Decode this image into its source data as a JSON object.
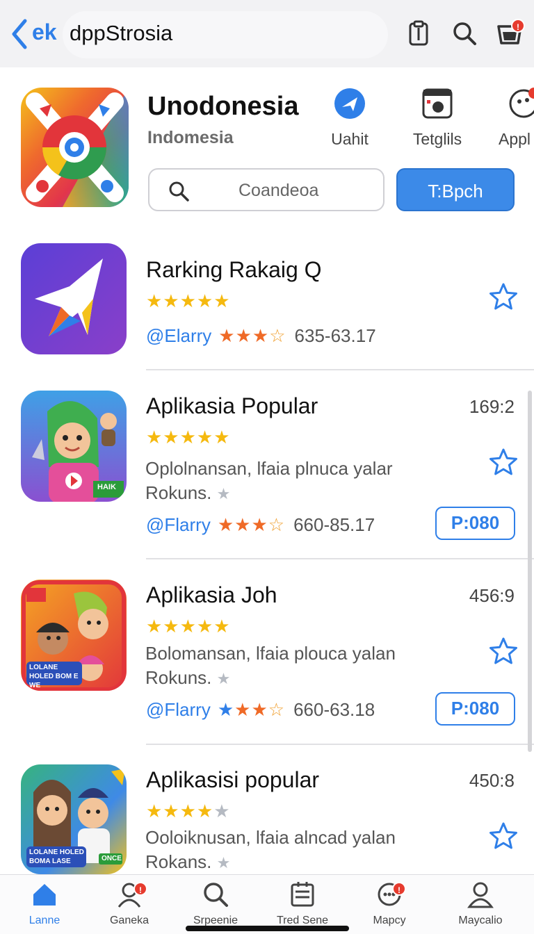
{
  "header": {
    "back_text": "ek",
    "title": "dppStrosia",
    "cart_badge": "!"
  },
  "featured": {
    "title": "Unodonesia",
    "subtitle": "Indomesia",
    "categories": [
      {
        "label": "Uahit",
        "icon": "plane-icon"
      },
      {
        "label": "Tetglils",
        "icon": "film-icon"
      },
      {
        "label": "Appl",
        "icon": "apps-icon"
      }
    ],
    "search_placeholder": "Coandeoa",
    "primary_button": "T:Bpch"
  },
  "apps": [
    {
      "name": "Rarking Rakaig Q",
      "rating": 4.5,
      "developer": "@Elarry",
      "small_rating": 3,
      "numbers": "635-63.17",
      "time": "",
      "description": "",
      "desc_line2": "",
      "price": ""
    },
    {
      "name": "Aplikasia Popular",
      "rating": 4.5,
      "developer": "@Flarry",
      "small_rating": 3,
      "numbers": "660-85.17",
      "time": "169:2",
      "description": "Oplolnansan, lfaia plnuca yalar",
      "desc_line2": "Rokuns.",
      "price": "P:080"
    },
    {
      "name": "Aplikasia Joh",
      "rating": 4.5,
      "developer": "@Flarry",
      "small_rating": 3,
      "numbers": "660-63.18",
      "time": "456:9",
      "description": "Bolomansan, lfaia plouca yalan",
      "desc_line2": "Rokuns.",
      "price": "P:080"
    },
    {
      "name": "Aplikasisi popular",
      "rating": 4,
      "developer": "",
      "small_rating": 0,
      "numbers": "",
      "time": "450:8",
      "description": "Ooloiknusan, lfaia alncad yalan",
      "desc_line2": "Rokans.",
      "price": ""
    }
  ],
  "icon_texts": {
    "app3_badge": "LOLANE HOLED BOM E WE",
    "app4_badge": "LOLANE HOLED BOMA LASE",
    "app2_tag": "HAIK",
    "app4_tag": "ONCE"
  },
  "tabs": [
    {
      "label": "Lanne",
      "icon": "home-icon",
      "active": true
    },
    {
      "label": "Ganeka",
      "icon": "person-icon",
      "badge": "!"
    },
    {
      "label": "Srpeenie",
      "icon": "search-icon"
    },
    {
      "label": "Tred Sene",
      "icon": "list-icon"
    },
    {
      "label": "Mapcy",
      "icon": "chat-icon",
      "badge": "!"
    },
    {
      "label": "Maycalio",
      "icon": "profile-icon"
    }
  ],
  "colors": {
    "accent": "#2f7fe8",
    "star": "#f5b90f",
    "badge": "#e63b2e"
  }
}
